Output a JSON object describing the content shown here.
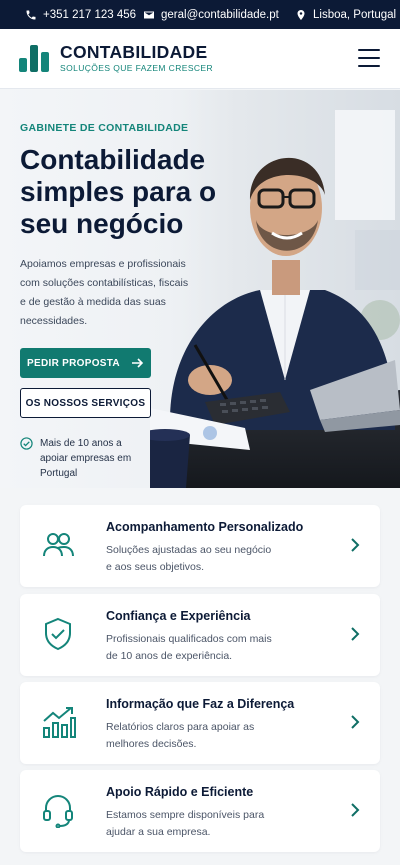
{
  "topbar": {
    "phone": "+351 217 123 456",
    "email": "geral@contabilidade.pt",
    "location": "Lisboa, Portugal"
  },
  "brand": {
    "name": "CONTABILIDADE",
    "tagline": "SOLUÇÕES QUE FAZEM CRESCER",
    "accent": "#14857a",
    "navy": "#0c1a36"
  },
  "hero": {
    "eyebrow": "GABINETE DE CONTABILIDADE",
    "title": "Contabilidade simples para o seu negócio",
    "lead": "Apoiamos empresas e profissionais com soluções contabilísticas, fiscais e de gestão à medida das suas necessidades.",
    "primary_cta": "PEDIR PROPOSTA",
    "secondary_cta": "OS NOSSOS SERVIÇOS",
    "trust": "Mais de 10 anos a apoiar empresas em Portugal"
  },
  "features": [
    {
      "icon": "users-icon",
      "title": "Acompanhamento Personalizado",
      "desc": "Soluções ajustadas ao seu negócio e aos seus objetivos."
    },
    {
      "icon": "shield-check-icon",
      "title": "Confiança e Experiência",
      "desc": "Profissionais qualificados com mais de 10 anos de experiência."
    },
    {
      "icon": "growth-chart-icon",
      "title": "Informação que Faz a Diferença",
      "desc": "Relatórios claros para apoiar as melhores decisões."
    },
    {
      "icon": "headset-icon",
      "title": "Apoio Rápido e Eficiente",
      "desc": "Estamos sempre disponíveis para ajudar a sua empresa."
    }
  ]
}
